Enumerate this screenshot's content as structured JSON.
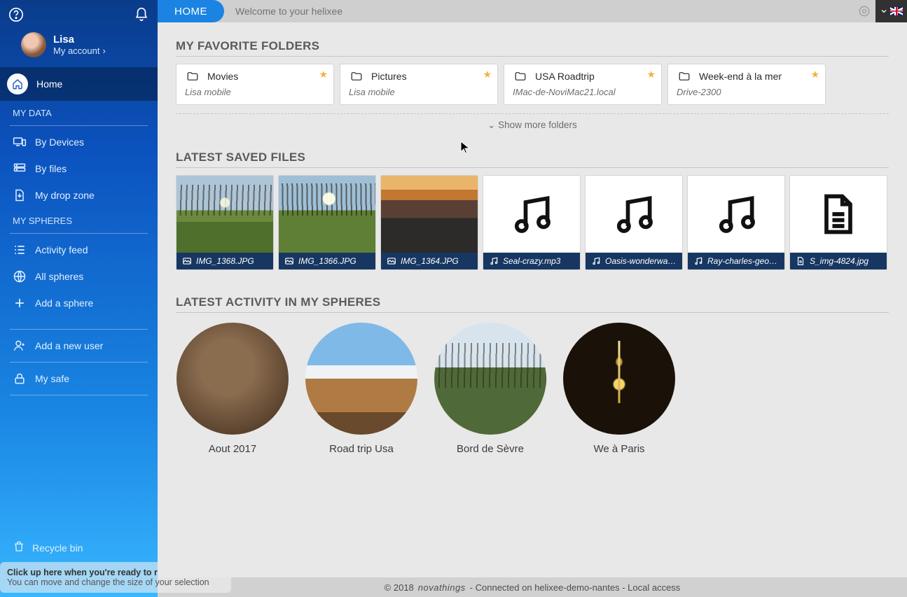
{
  "sidebar": {
    "user_name": "Lisa",
    "user_sub": "My account",
    "home": "Home",
    "section_data": "MY DATA",
    "by_devices": "By Devices",
    "by_files": "By files",
    "drop_zone": "My drop zone",
    "section_spheres": "MY SPHERES",
    "activity_feed": "Activity feed",
    "all_spheres": "All spheres",
    "add_sphere": "Add a sphere",
    "add_user": "Add a new user",
    "my_safe": "My safe",
    "recycle": "Recycle bin",
    "tip_line1": "Click up here when you're ready to record!",
    "tip_line2": "You can move and change the size of your selection"
  },
  "topbar": {
    "home": "HOME",
    "welcome": "Welcome to your helixee"
  },
  "sections": {
    "fav": "MY FAVORITE FOLDERS",
    "files": "LATEST SAVED FILES",
    "spheres": "LATEST ACTIVITY IN MY SPHERES",
    "show_more": "Show more folders"
  },
  "folders": [
    {
      "name": "Movies",
      "sub": "Lisa mobile"
    },
    {
      "name": "Pictures",
      "sub": "Lisa mobile"
    },
    {
      "name": "USA Roadtrip",
      "sub": "IMac-de-NoviMac21.local"
    },
    {
      "name": "Week-end à la mer",
      "sub": "Drive-2300"
    }
  ],
  "files": [
    {
      "name": "IMG_1368.JPG",
      "type": "image"
    },
    {
      "name": "IMG_1366.JPG",
      "type": "image"
    },
    {
      "name": "IMG_1364.JPG",
      "type": "image"
    },
    {
      "name": "Seal-crazy.mp3",
      "type": "audio"
    },
    {
      "name": "Oasis-wonderwall....",
      "type": "audio"
    },
    {
      "name": "Ray-charles-georgi...",
      "type": "audio"
    },
    {
      "name": "S_img-4824.jpg",
      "type": "doc"
    }
  ],
  "spheres": [
    {
      "label": "Aout 2017"
    },
    {
      "label": "Road trip Usa"
    },
    {
      "label": "Bord de Sèvre"
    },
    {
      "label": "We à Paris"
    }
  ],
  "footer": {
    "copyright": "© 2018",
    "brand": "novathings",
    "status": "- Connected on helixee-demo-nantes - Local access"
  }
}
